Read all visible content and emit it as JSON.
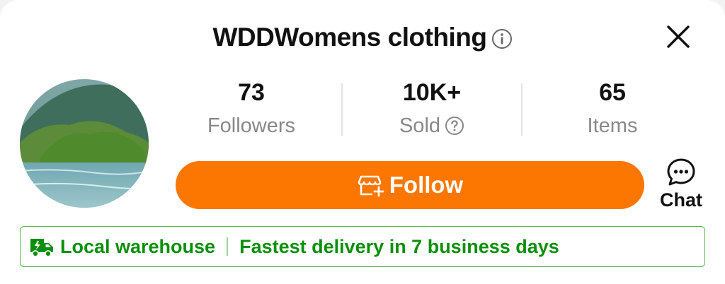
{
  "shop": {
    "name": "WDDWomens clothing",
    "avatar_alt": "store avatar"
  },
  "stats": [
    {
      "value": "73",
      "label": "Followers"
    },
    {
      "value": "10K+",
      "label": "Sold"
    },
    {
      "value": "65",
      "label": "Items"
    }
  ],
  "actions": {
    "follow_label": "Follow",
    "chat_label": "Chat"
  },
  "banner": {
    "primary": "Local warehouse",
    "secondary": "Fastest delivery in 7 business days"
  },
  "colors": {
    "accent": "#fb7701",
    "banner_green": "#0a8f08"
  },
  "icons": {
    "info": "info-icon",
    "close": "close-icon",
    "help": "question-icon",
    "follow": "store-plus-icon",
    "chat": "chat-bubble-icon",
    "truck": "truck-icon"
  }
}
